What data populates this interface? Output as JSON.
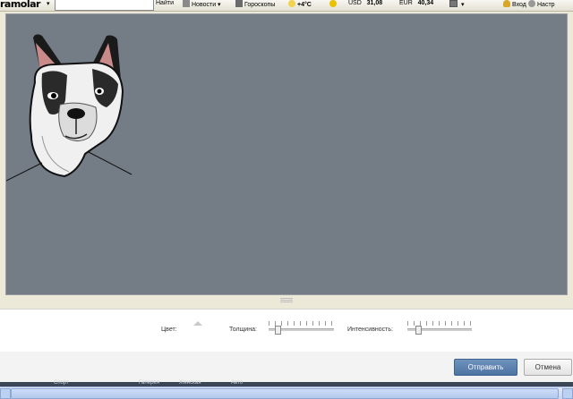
{
  "toolbar": {
    "logo": "ramolar",
    "search_value": "",
    "find_label": "Найти",
    "news_label": "Новости",
    "horoscope_label": "Гороскопы",
    "weather": "+4°C",
    "usd_label": "USD",
    "usd_value": "31,08",
    "eur_label": "EUR",
    "eur_value": "40,34",
    "login_label": "Вход",
    "settings_label": "Настр"
  },
  "controls": {
    "color_label": "Цвет:",
    "thickness_label": "Толщина:",
    "intensity_label": "Интенсивность:",
    "thickness_level": 0.1,
    "intensity_level": 0.15
  },
  "buttons": {
    "send_label": "Отправить",
    "cancel_label": "Отмена"
  },
  "background_page": {
    "items": [
      "Спорт",
      "Галерея",
      "Женская",
      "Авто"
    ]
  },
  "colors": {
    "canvas": "#747c85",
    "send_button": "#5b7fae"
  }
}
